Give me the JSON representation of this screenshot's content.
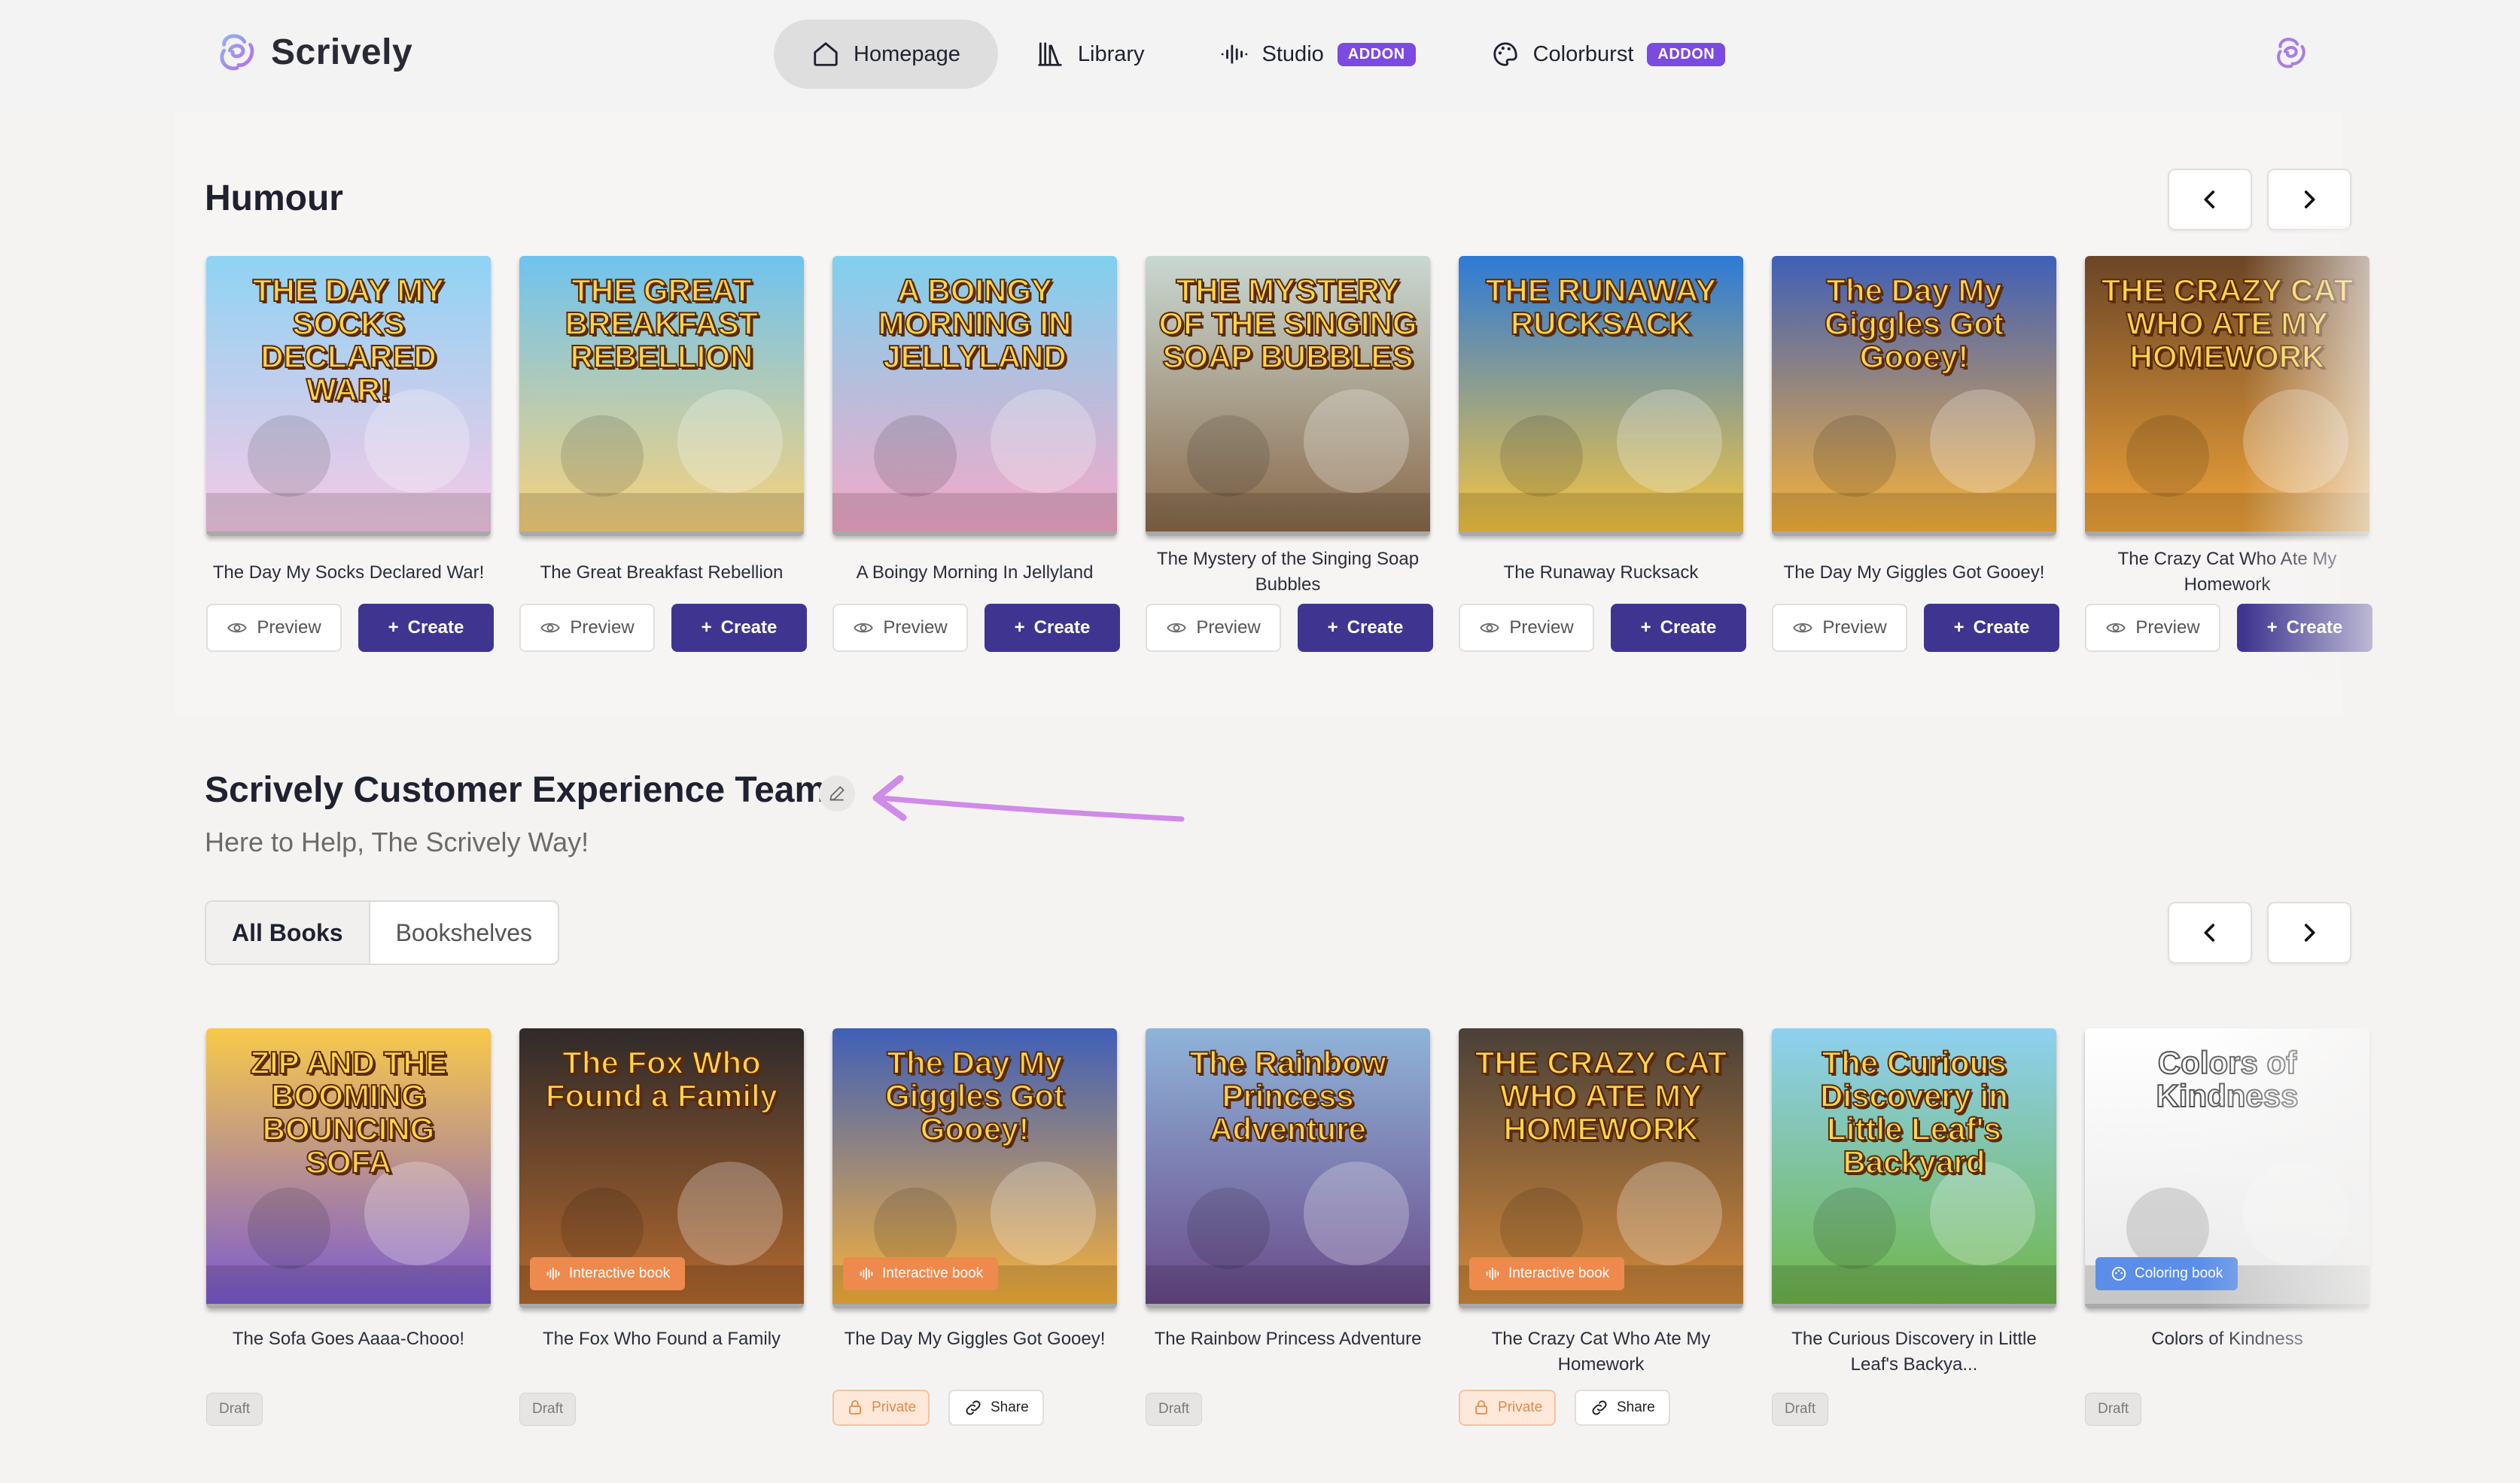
{
  "brand": {
    "name": "Scrively"
  },
  "nav": {
    "items": [
      {
        "label": "Homepage",
        "icon": "home-icon",
        "addon": ""
      },
      {
        "label": "Library",
        "icon": "library-icon",
        "addon": ""
      },
      {
        "label": "Studio",
        "icon": "audio-wave-icon",
        "addon": "ADDON"
      },
      {
        "label": "Colorburst",
        "icon": "palette-icon",
        "addon": "ADDON"
      }
    ]
  },
  "humour": {
    "title": "Humour",
    "preview_label": "Preview",
    "create_label": "Create",
    "books": [
      {
        "title": "The Day My Socks Declared War!",
        "cover_text": "THE DAY MY SOCKS DECLARED WAR!",
        "colors": [
          "#8fd3f4",
          "#f7c9e6"
        ]
      },
      {
        "title": "The Great Breakfast Rebellion",
        "cover_text": "THE GREAT BREAKFAST REBELLION",
        "colors": [
          "#6fc3ef",
          "#f9d27b"
        ]
      },
      {
        "title": "A Boingy Morning In Jellyland",
        "cover_text": "A BOINGY MORNING IN JELLYLAND",
        "colors": [
          "#7fd0ee",
          "#f5a9c8"
        ]
      },
      {
        "title": "The Mystery of the Singing Soap Bubbles",
        "cover_text": "THE MYSTERY OF THE SINGING SOAP BUBBLES",
        "colors": [
          "#c9d8d2",
          "#8a6a4a"
        ]
      },
      {
        "title": "The Runaway Rucksack",
        "cover_text": "THE RUNAWAY RUCKSACK",
        "colors": [
          "#2d7ad6",
          "#f6c540"
        ]
      },
      {
        "title": "The Day My Giggles Got Gooey!",
        "cover_text": "The Day My Giggles Got Gooey!",
        "colors": [
          "#3f5fb8",
          "#f8b23a"
        ]
      },
      {
        "title": "The Crazy Cat Who Ate My Homework",
        "cover_text": "THE CRAZY CAT WHO ATE MY HOMEWORK",
        "colors": [
          "#6b4526",
          "#f0a43a"
        ]
      }
    ]
  },
  "team": {
    "title": "Scrively Customer Experience Team",
    "subtitle": "Here to Help, The Scrively Way!",
    "tabs": [
      "All Books",
      "Bookshelves"
    ],
    "private_label": "Private",
    "share_label": "Share",
    "draft_label": "Draft",
    "books": [
      {
        "title": "The Sofa Goes Aaaa-Chooo!",
        "cover_text": "ZIP AND THE BOOMING BOUNCING SOFA",
        "badge": "",
        "status": "Draft",
        "colors": [
          "#f8c94a",
          "#7b5ad2"
        ]
      },
      {
        "title": "The Fox Who Found a Family",
        "cover_text": "The Fox Who Found a Family",
        "badge": "Interactive book",
        "status": "Draft",
        "colors": [
          "#2f2a2a",
          "#b4692e"
        ]
      },
      {
        "title": "The Day My Giggles Got Gooey!",
        "cover_text": "The Day My Giggles Got Gooey!",
        "badge": "Interactive book",
        "status": "Private",
        "colors": [
          "#3f5fb8",
          "#f8b23a"
        ]
      },
      {
        "title": "The Rainbow Princess Adventure",
        "cover_text": "The Rainbow Princess Adventure",
        "badge": "",
        "status": "Draft",
        "colors": [
          "#8fb4d9",
          "#6a4a8a"
        ]
      },
      {
        "title": "The Crazy Cat Who Ate My Homework",
        "cover_text": "THE CRAZY CAT WHO ATE MY HOMEWORK",
        "badge": "Interactive book",
        "status": "Private",
        "colors": [
          "#4a4038",
          "#d48a3a"
        ]
      },
      {
        "title": "The Curious Discovery in Little Leaf's Backya...",
        "cover_text": "The Curious Discovery in Little Leaf's Backyard",
        "badge": "",
        "status": "Draft",
        "colors": [
          "#8fd0f0",
          "#6fb64a"
        ]
      },
      {
        "title": "Colors of Kindness",
        "cover_text": "Colors of Kindness",
        "badge": "Coloring book",
        "status": "Draft",
        "colors": [
          "#ffffff",
          "#e9e9e9"
        ]
      }
    ]
  }
}
